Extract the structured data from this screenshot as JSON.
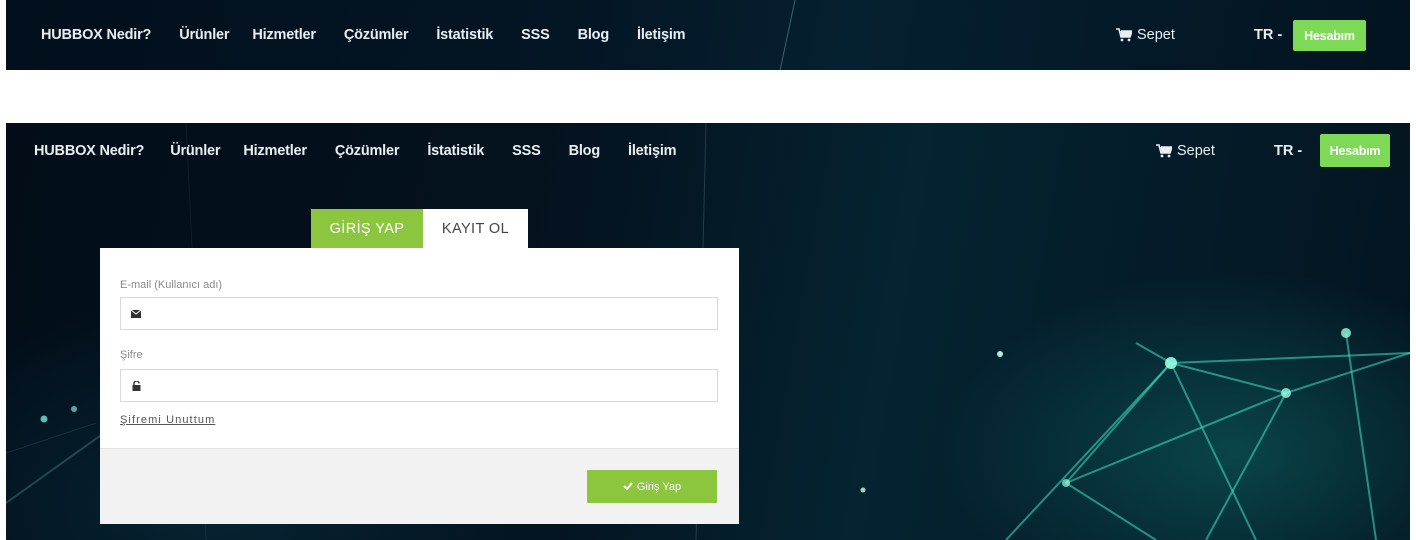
{
  "nav": {
    "items": [
      {
        "label": "HUBBOX Nedir?"
      },
      {
        "label": "Ürünler"
      },
      {
        "label": "Hizmetler"
      },
      {
        "label": "Çözümler"
      },
      {
        "label": "İstatistik"
      },
      {
        "label": "SSS"
      },
      {
        "label": "Blog"
      },
      {
        "label": "İletişim"
      }
    ],
    "cart_label": "Sepet",
    "cart_icon": "cart-icon",
    "lang_label": "TR -",
    "account_label": "Hesabım"
  },
  "login": {
    "tabs": [
      {
        "label": "GİRİŞ YAP",
        "active": true
      },
      {
        "label": "KAYIT OL",
        "active": false
      }
    ],
    "email_label": "E-mail (Kullanıcı adı)",
    "email_value": "",
    "email_icon": "envelope-icon",
    "password_label": "Şifre",
    "password_value": "",
    "password_icon": "unlock-icon",
    "forgot_label": "Şifremi Unuttum",
    "submit_label": "Giriş Yap",
    "submit_icon": "check-icon"
  },
  "colors": {
    "accent_green": "#8cc63f",
    "account_green": "#7ed957",
    "nav_bg": "#041524"
  }
}
